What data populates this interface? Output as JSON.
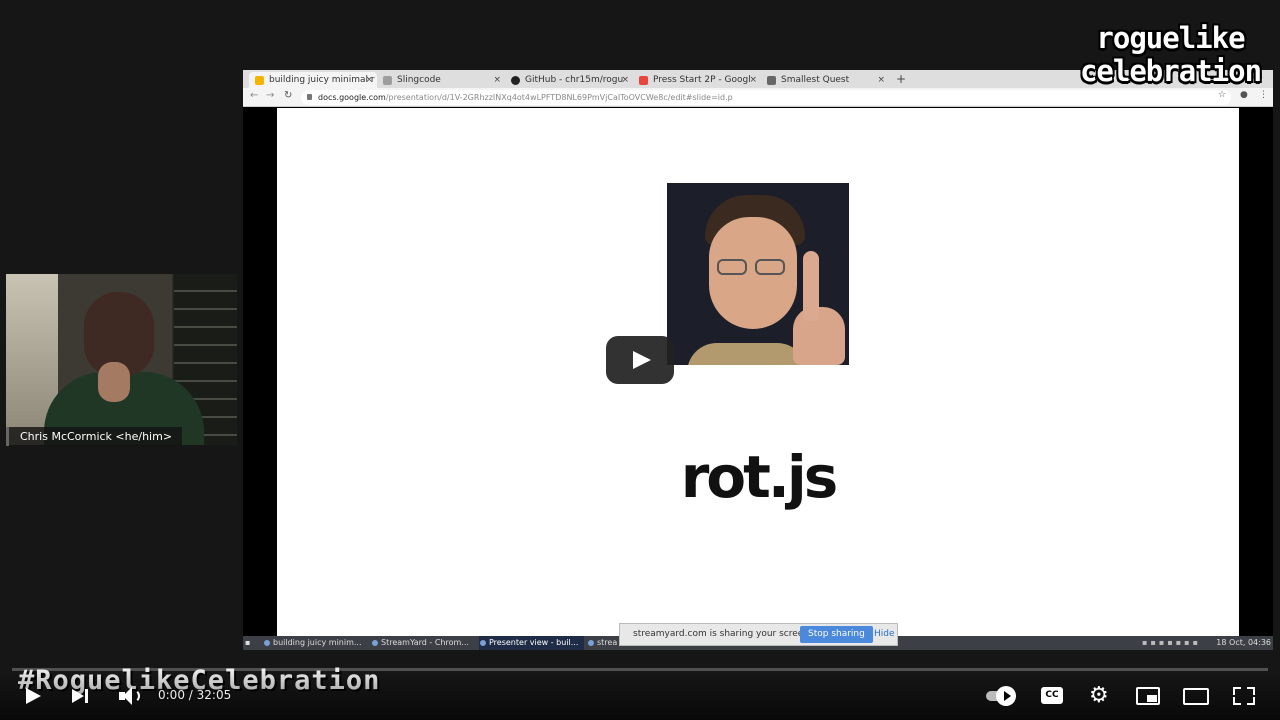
{
  "browser": {
    "tabs": [
      {
        "label": "building juicy minimal r",
        "favicon_color": "#f4b400"
      },
      {
        "label": "Slingcode",
        "favicon_color": "#9e9e9e"
      },
      {
        "label": "GitHub - chr15m/rogu",
        "favicon_color": "#222222"
      },
      {
        "label": "Press Start 2P - Googl",
        "favicon_color": "#e8453c"
      },
      {
        "label": "Smallest Quest",
        "favicon_color": "#666666"
      }
    ],
    "url_host": "docs.google.com",
    "url_path": "/presentation/d/1V-2GRhzzINXq4ot4wLPFTD8NL69PmVjCaIToOVCWe8c/edit#slide=id.p"
  },
  "slide": {
    "title": "rot.js"
  },
  "taskbar": {
    "items": [
      "building juicy minim...",
      "StreamYard - Chrom...",
      "Presenter view - buil...",
      "strea"
    ],
    "clock": "18 Oct, 04:36"
  },
  "share_bar": {
    "message": "streamyard.com is sharing your screen.",
    "stop_label": "Stop sharing",
    "hide_label": "Hide"
  },
  "webcam": {
    "name": "Chris McCormick <he/him>"
  },
  "overlay": {
    "brand_line1": "roguelike",
    "brand_line2": "celebration",
    "hashtag": "#RoguelikeCelebration"
  },
  "player": {
    "current_time": "0:00",
    "duration": "32:05",
    "time_separator": " / ",
    "cc_label": "CC",
    "progress": 0
  }
}
